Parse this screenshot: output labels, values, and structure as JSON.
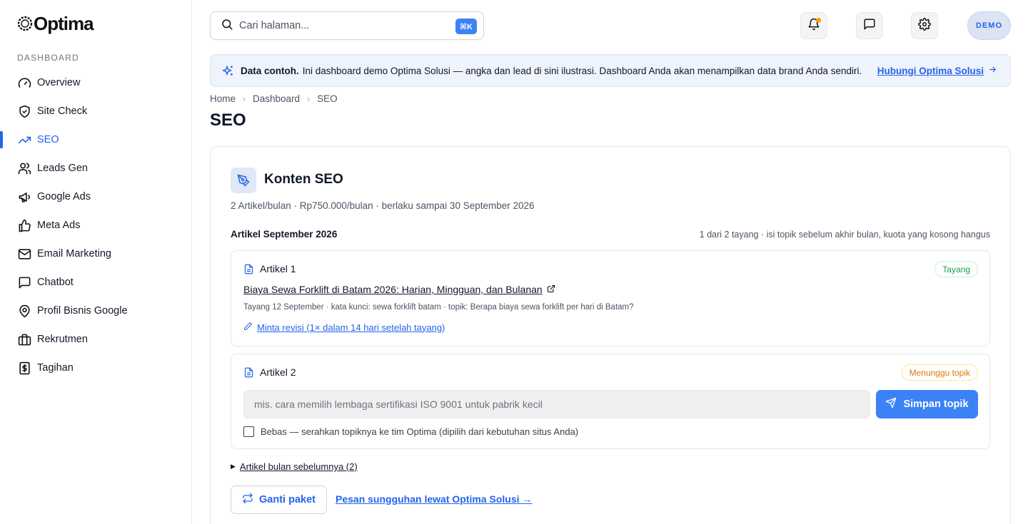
{
  "app": {
    "logo_text": "Optima"
  },
  "sidebar": {
    "section_label": "DASHBOARD",
    "items": [
      {
        "label": "Overview",
        "icon": "gauge-icon",
        "active": false
      },
      {
        "label": "Site Check",
        "icon": "shield-check-icon",
        "active": false
      },
      {
        "label": "SEO",
        "icon": "trending-up-icon",
        "active": true
      },
      {
        "label": "Leads Gen",
        "icon": "users-icon",
        "active": false
      },
      {
        "label": "Google Ads",
        "icon": "megaphone-icon",
        "active": false
      },
      {
        "label": "Meta Ads",
        "icon": "thumbs-up-icon",
        "active": false
      },
      {
        "label": "Email Marketing",
        "icon": "mail-icon",
        "active": false
      },
      {
        "label": "Chatbot",
        "icon": "message-square-icon",
        "active": false
      },
      {
        "label": "Profil Bisnis Google",
        "icon": "map-pin-icon",
        "active": false
      },
      {
        "label": "Rekrutmen",
        "icon": "briefcase-icon",
        "active": false
      },
      {
        "label": "Tagihan",
        "icon": "receipt-dollar-icon",
        "active": false
      }
    ]
  },
  "topbar": {
    "search_placeholder": "Cari halaman...",
    "search_shortcut": "⌘K",
    "avatar_label": "DEMO",
    "notification_dot_color": "#f59e0b"
  },
  "banner": {
    "bold": "Data contoh.",
    "text": "Ini dashboard demo Optima Solusi — angka dan lead di sini ilustrasi. Dashboard Anda akan menampilkan data brand Anda sendiri.",
    "link": "Hubungi Optima Solusi"
  },
  "breadcrumb": [
    "Home",
    "Dashboard",
    "SEO"
  ],
  "page_title": "SEO",
  "card": {
    "title": "Konten SEO",
    "subtitle": "2 Artikel/bulan · Rp750.000/bulan · berlaku sampai 30 September 2026",
    "month_title": "Artikel September 2026",
    "month_meta": "1 dari 2 tayang · isi topik sebelum akhir bulan, kuota yang kosong hangus",
    "article1": {
      "label": "Artikel 1",
      "status": "Tayang",
      "title": "Biaya Sewa Forklift di Batam 2026: Harian, Mingguan, dan Bulanan",
      "meta": "Tayang 12 September · kata kunci: sewa forklift batam · topik: Berapa biaya sewa forklift per hari di Batam?",
      "revision_link": "Minta revisi (1× dalam 14 hari setelah tayang)"
    },
    "article2": {
      "label": "Artikel 2",
      "status": "Menunggu topik",
      "input_placeholder": "mis. cara memilih lembaga sertifikasi ISO 9001 untuk pabrik kecil",
      "input_value": "",
      "save_label": "Simpan topik",
      "free_label": "Bebas — serahkan topiknya ke tim Optima (dipilih dari kebutuhan situs Anda)",
      "free_checked": false
    },
    "previous_toggle": "Artikel bulan sebelumnya (2)",
    "change_plan": "Ganti paket",
    "order_link": "Pesan sungguhan lewat Optima Solusi →"
  },
  "colors": {
    "accent": "#2563eb",
    "live": "#16a34a",
    "waiting": "#d97706"
  }
}
